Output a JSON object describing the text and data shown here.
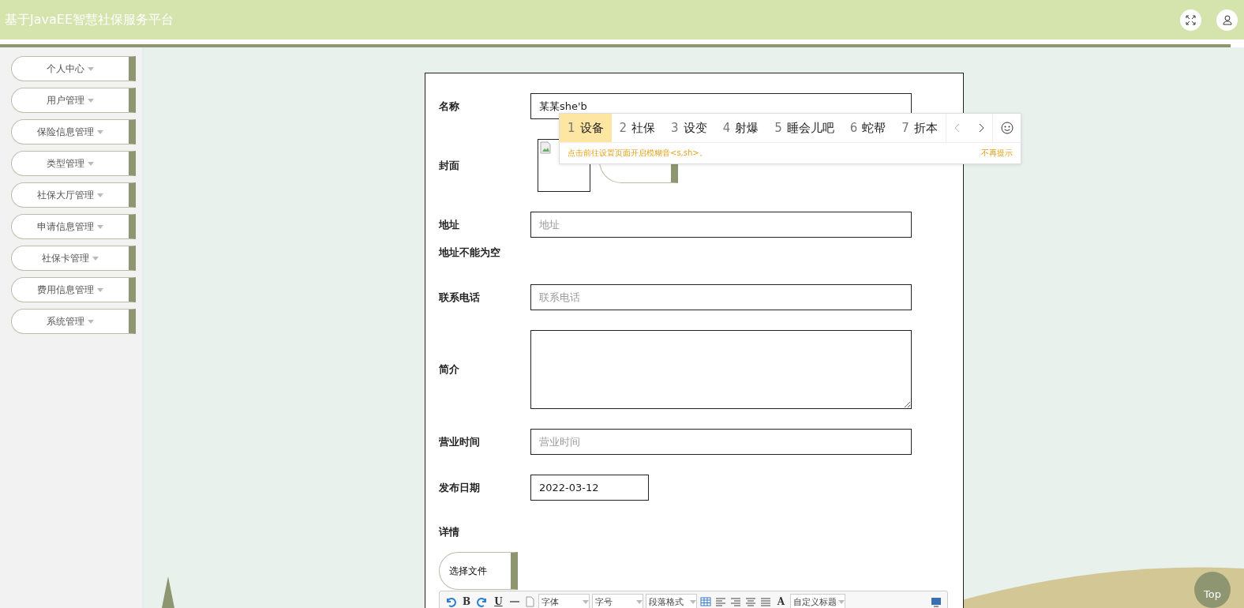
{
  "header": {
    "title": "基于JavaEE智慧社保服务平台",
    "actions": [
      {
        "kind": "fullscreen"
      },
      {
        "kind": "user"
      }
    ]
  },
  "sidebar": {
    "items": [
      {
        "label": "个人中心"
      },
      {
        "label": "用户管理"
      },
      {
        "label": "保险信息管理"
      },
      {
        "label": "类型管理"
      },
      {
        "label": "社保大厅管理"
      },
      {
        "label": "申请信息管理"
      },
      {
        "label": "社保卡管理"
      },
      {
        "label": "费用信息管理"
      },
      {
        "label": "系统管理"
      }
    ]
  },
  "form": {
    "fields": [
      {
        "kind": "text",
        "label": "名称",
        "value": "某某she'b"
      },
      {
        "kind": "image",
        "label": "封面"
      },
      {
        "kind": "text",
        "label": "地址",
        "placeholder": "地址",
        "error": "地址不能为空"
      },
      {
        "kind": "text",
        "label": "联系电话",
        "placeholder": "联系电话"
      },
      {
        "kind": "textarea",
        "label": "简介"
      },
      {
        "kind": "text",
        "label": "营业时间",
        "placeholder": "营业时间"
      },
      {
        "kind": "date",
        "label": "发布日期",
        "value": "2022-03-12"
      },
      {
        "kind": "editor",
        "label": "详情",
        "button": "选择文件"
      }
    ],
    "toolbar": [
      {
        "kind": "undo"
      },
      {
        "kind": "glyph",
        "label": "B"
      },
      {
        "kind": "redo"
      },
      {
        "kind": "underline",
        "label": "U"
      },
      {
        "kind": "rule"
      },
      {
        "kind": "page"
      },
      {
        "kind": "select",
        "label": "字体"
      },
      {
        "kind": "select",
        "label": "字号"
      },
      {
        "kind": "select",
        "label": "段落格式"
      },
      {
        "kind": "table"
      },
      {
        "kind": "align-left"
      },
      {
        "kind": "align-right"
      },
      {
        "kind": "align-center"
      },
      {
        "kind": "align-justify"
      },
      {
        "kind": "glyph-menu",
        "label": "A"
      },
      {
        "kind": "select",
        "label": "自定义标题"
      },
      {
        "kind": "spacer"
      },
      {
        "kind": "preview"
      }
    ]
  },
  "ime": {
    "candidates": [
      {
        "index": "1",
        "text": "设备",
        "selected": true
      },
      {
        "index": "2",
        "text": "社保",
        "selected": false
      },
      {
        "index": "3",
        "text": "设变",
        "selected": false
      },
      {
        "index": "4",
        "text": "射爆",
        "selected": false
      },
      {
        "index": "5",
        "text": "睡会儿吧",
        "selected": false
      },
      {
        "index": "6",
        "text": "蛇帮",
        "selected": false
      },
      {
        "index": "7",
        "text": "折本",
        "selected": false
      }
    ],
    "hint": "点击前往设置页面开启模糊音<s,sh>。",
    "dismiss": "不再提示"
  },
  "top_button": {
    "label": "Top"
  }
}
